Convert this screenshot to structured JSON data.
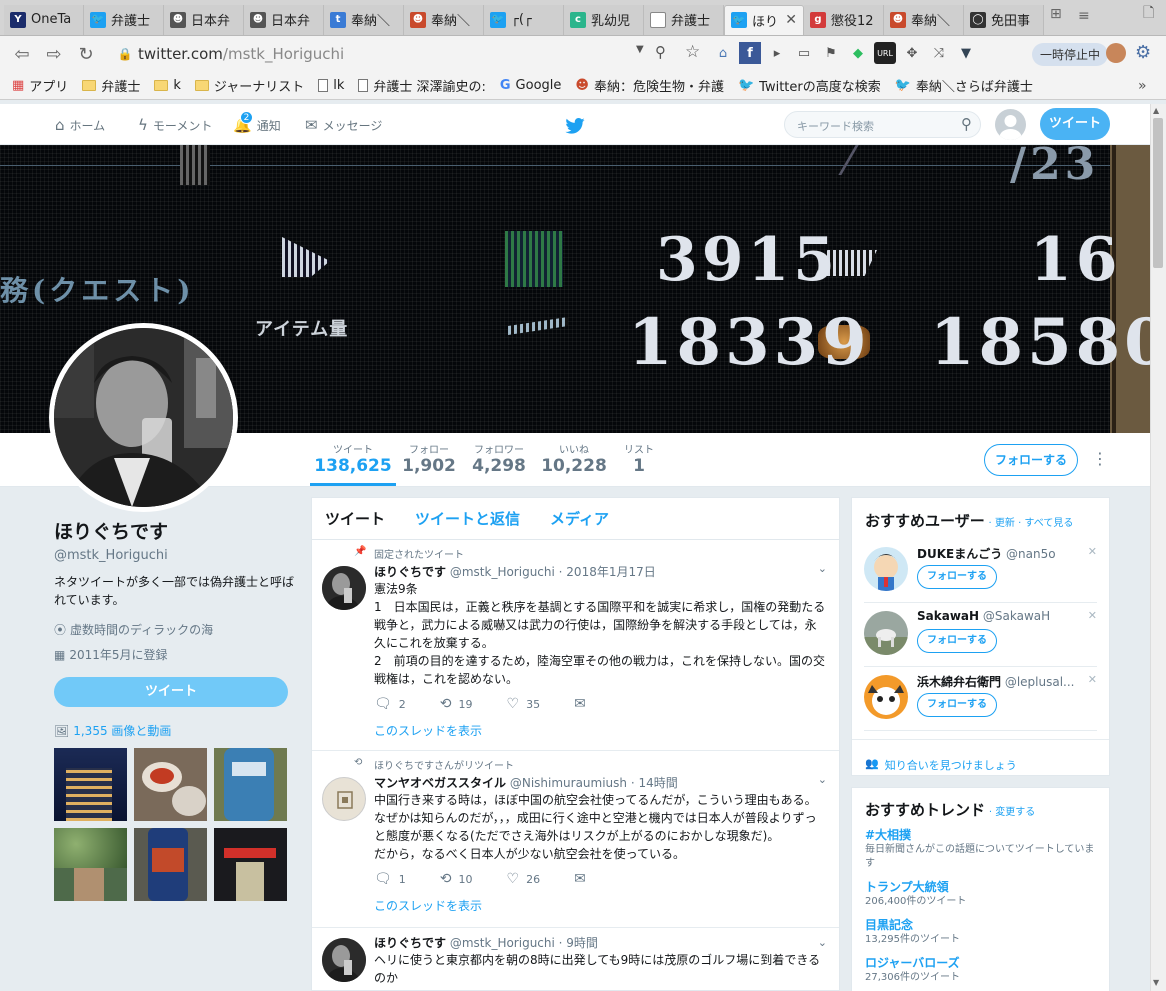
{
  "browser": {
    "tabs": [
      {
        "label": "OneTa",
        "icon": "onetab-icon",
        "color": "#1b2c6b",
        "glyph": "Y"
      },
      {
        "label": "弁護士",
        "icon": "twitter-icon",
        "color": "#1da1f2",
        "glyph": "🐦"
      },
      {
        "label": "日本弁",
        "icon": "hatena-icon",
        "color": "#555555",
        "glyph": "☻"
      },
      {
        "label": "日本弁",
        "icon": "hatena-icon",
        "color": "#555555",
        "glyph": "☻"
      },
      {
        "label": "奉納＼",
        "icon": "blog-icon",
        "color": "#3a7bd5",
        "glyph": "t"
      },
      {
        "label": "奉納＼",
        "icon": "hatena-blog-icon",
        "color": "#c94a2c",
        "glyph": "☻"
      },
      {
        "label": "┌(┌",
        "icon": "twitter-icon",
        "color": "#1da1f2",
        "glyph": "🐦"
      },
      {
        "label": "乳幼児",
        "icon": "site-icon",
        "color": "#2bb58c",
        "glyph": "c"
      },
      {
        "label": "弁護士",
        "icon": "page-icon",
        "color": "#ffffff",
        "glyph": ""
      },
      {
        "label": "ほり",
        "icon": "twitter-icon",
        "color": "#1da1f2",
        "glyph": "🐦",
        "active": true
      },
      {
        "label": "懲役12",
        "icon": "gunosy-icon",
        "color": "#d33b3b",
        "glyph": "g"
      },
      {
        "label": "奉納＼",
        "icon": "hatena-blog-icon",
        "color": "#c94a2c",
        "glyph": "☻"
      },
      {
        "label": "免田事",
        "icon": "site-icon",
        "color": "#333333",
        "glyph": "◯"
      }
    ],
    "url_domain": "twitter.com",
    "url_path": "/mstk_Horiguchi",
    "pause_label": "一時停止中",
    "bookmarks": [
      {
        "label": "アプリ",
        "type": "apps"
      },
      {
        "label": "弁護士",
        "type": "folder"
      },
      {
        "label": "k",
        "type": "folder"
      },
      {
        "label": "ジャーナリスト",
        "type": "folder"
      },
      {
        "label": "lk",
        "type": "page"
      },
      {
        "label": "弁護士 深澤諭史の:",
        "type": "page"
      },
      {
        "label": "Google",
        "type": "google"
      },
      {
        "label": "奉納：危険生物・弁護",
        "type": "hatena"
      },
      {
        "label": "Twitterの高度な検索",
        "type": "twitter"
      },
      {
        "label": "奉納＼さらば弁護士",
        "type": "twitter"
      }
    ]
  },
  "twitter": {
    "nav": {
      "home": "ホーム",
      "moments": "モーメント",
      "notifications": "通知",
      "messages": "メッセージ",
      "badge": "2"
    },
    "search_placeholder": "キーワード検索",
    "tweet_button": "ツイート",
    "banner_numbers": {
      "n1": "3915",
      "n2": "16",
      "n3": "18339",
      "n4": "18580",
      "label1": "務(クエスト)",
      "label2": "アイテム量",
      "top": "/23"
    },
    "stats": [
      {
        "label": "ツイート",
        "value": "138,625"
      },
      {
        "label": "フォロー",
        "value": "1,902"
      },
      {
        "label": "フォロワー",
        "value": "4,298"
      },
      {
        "label": "いいね",
        "value": "10,228"
      },
      {
        "label": "リスト",
        "value": "1"
      }
    ],
    "follow_label": "フォローする",
    "profile": {
      "name": "ほりぐちです",
      "screen_name": "@mstk_Horiguchi",
      "bio": "ネタツイートが多く一部では偽弁護士と呼ばれています。",
      "location": "虚数時間のディラックの海",
      "joined": "2011年5月に登録",
      "tweet_label": "ツイート",
      "media_label": "1,355 画像と動画"
    },
    "timeline_tabs": [
      "ツイート",
      "ツイートと返信",
      "メディア"
    ],
    "tweets": [
      {
        "context": "固定されたツイート",
        "name": "ほりぐちです",
        "handle": "@mstk_Horiguchi",
        "time": "· 2018年1月17日",
        "lines": [
          "憲法9条",
          "1　日本国民は，正義と秩序を基調とする国際平和を誠実に希求し，国権の発動たる戦争と，武力による威嚇又は武力の行使は，国際紛争を解決する手段としては，永久にこれを放棄する。",
          "2　前項の目的を達するため，陸海空軍その他の戦力は，これを保持しない。国の交戦権は，これを認めない。"
        ],
        "replies": "2",
        "retweets": "19",
        "likes": "35",
        "thread": "このスレッドを表示"
      },
      {
        "context": "ほりぐちですさんがリツイート",
        "name": "マンヤオベガススタイル",
        "handle": "@Nishimuraumiush",
        "time": "· 14時間",
        "lines": [
          "中国行き来する時は，ほぼ中国の航空会社使ってるんだが，こういう理由もある。",
          "なぜかは知らんのだが，，，成田に行く途中と空港と機内では日本人が普段よりずっと態度が悪くなる(ただでさえ海外はリスクが上がるのにおかしな現象だ)。",
          "だから，なるべく日本人が少ない航空会社を使っている。"
        ],
        "replies": "1",
        "retweets": "10",
        "likes": "26",
        "thread": "このスレッドを表示"
      },
      {
        "name": "ほりぐちです",
        "handle": "@mstk_Horiguchi",
        "time": "· 9時間",
        "lines": [
          "ヘリに使うと東京都内を朝の8時に出発しても9時には茂原のゴルフ場に到着できるのか"
        ]
      }
    ],
    "who_to_follow": {
      "title": "おすすめユーザー",
      "links": "· 更新 · すべて見る",
      "users": [
        {
          "name": "DUKEまんごう",
          "handle": "@nan5o"
        },
        {
          "name": "SakawaH",
          "handle": "@SakawaH"
        },
        {
          "name": "浜木綿弁右衛門",
          "handle": "@leplusal..."
        }
      ],
      "follow_label": "フォローする",
      "find_friends": "知り合いを見つけましょう"
    },
    "trends": {
      "title": "おすすめトレンド",
      "change": "· 変更する",
      "items": [
        {
          "name": "#大相撲",
          "count": "毎日新聞さんがこの話題についてツイートしています"
        },
        {
          "name": "トランプ大統領",
          "count": "206,400件のツイート"
        },
        {
          "name": "目黒記念",
          "count": "13,295件のツイート"
        },
        {
          "name": "ロジャーバローズ",
          "count": "27,306件のツイート"
        }
      ]
    }
  }
}
